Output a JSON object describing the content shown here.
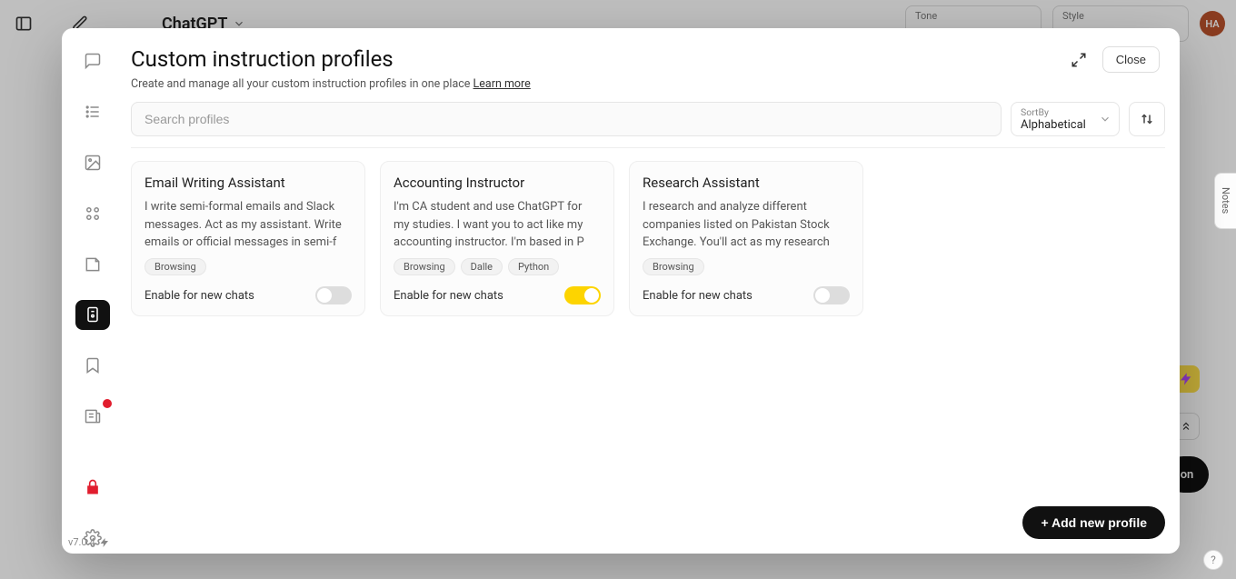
{
  "background": {
    "title": "ChatGPT",
    "tone_label": "Tone",
    "style_label": "Style",
    "avatar_initials": "HA",
    "notes_tab": "Notes",
    "version": "v7.0.4",
    "pill_text": "on"
  },
  "modal": {
    "title": "Custom instruction profiles",
    "subtitle": "Create and manage all your custom instruction profiles in one place",
    "learn_more": "Learn more",
    "close_label": "Close",
    "search_placeholder": "Search profiles",
    "sort_label": "SortBy",
    "sort_value": "Alphabetical",
    "add_button": "+ Add new profile",
    "enable_label": "Enable for new chats"
  },
  "profiles": [
    {
      "title": "Email Writing Assistant",
      "desc": "I write semi-formal emails and Slack messages. Act as my assistant. Write emails or official messages in semi-f",
      "tags": [
        "Browsing"
      ],
      "enabled": false
    },
    {
      "title": "Accounting Instructor",
      "desc": "I'm CA student and use ChatGPT for my studies. I want you to act like my accounting instructor. I'm based in P",
      "tags": [
        "Browsing",
        "Dalle",
        "Python"
      ],
      "enabled": true
    },
    {
      "title": "Research Assistant",
      "desc": "I research and analyze different companies listed on Pakistan Stock Exchange. You'll act as my research assista",
      "tags": [
        "Browsing"
      ],
      "enabled": false
    }
  ]
}
